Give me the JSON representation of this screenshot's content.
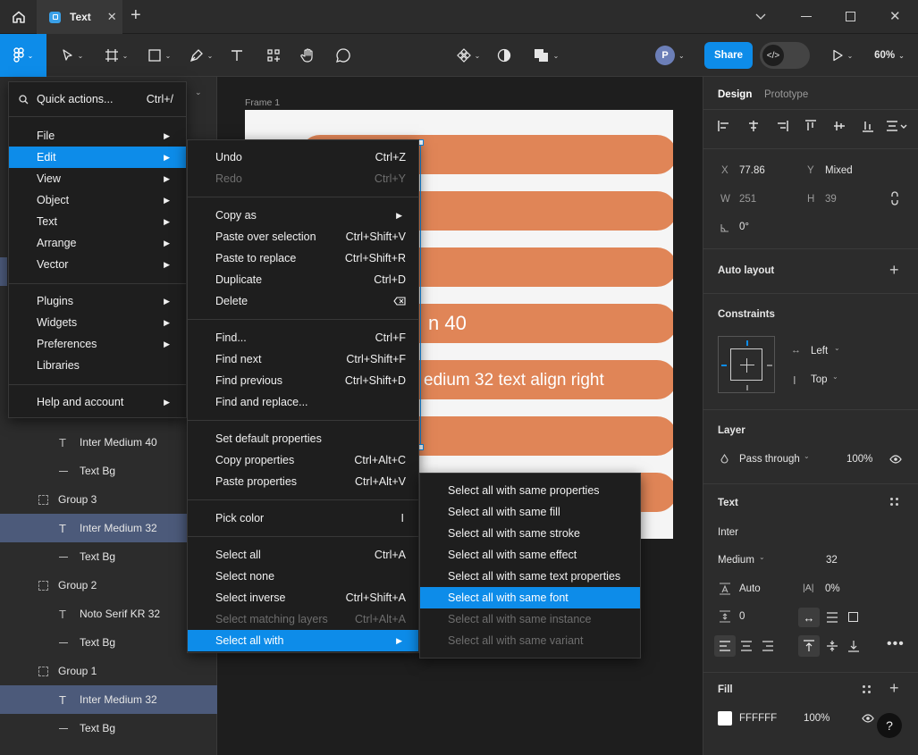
{
  "titlebar": {
    "tab_title": "Text",
    "plus_label": "+"
  },
  "toolbar": {
    "share_label": "Share",
    "avatar_initial": "P",
    "zoom_label": "60%"
  },
  "main_menu": {
    "search_label": "Quick actions...",
    "search_shortcut": "Ctrl+/",
    "items": [
      {
        "label": "File"
      },
      {
        "label": "Edit"
      },
      {
        "label": "View"
      },
      {
        "label": "Object"
      },
      {
        "label": "Text"
      },
      {
        "label": "Arrange"
      },
      {
        "label": "Vector"
      },
      {
        "label": "Plugins"
      },
      {
        "label": "Widgets"
      },
      {
        "label": "Preferences"
      },
      {
        "label": "Libraries"
      },
      {
        "label": "Help and account"
      }
    ]
  },
  "edit_menu": {
    "items": [
      {
        "label": "Undo",
        "shortcut": "Ctrl+Z"
      },
      {
        "label": "Redo",
        "shortcut": "Ctrl+Y"
      },
      {
        "label": "Copy as",
        "shortcut": ""
      },
      {
        "label": "Paste over selection",
        "shortcut": "Ctrl+Shift+V"
      },
      {
        "label": "Paste to replace",
        "shortcut": "Ctrl+Shift+R"
      },
      {
        "label": "Duplicate",
        "shortcut": "Ctrl+D"
      },
      {
        "label": "Delete",
        "shortcut": ""
      },
      {
        "label": "Find...",
        "shortcut": "Ctrl+F"
      },
      {
        "label": "Find next",
        "shortcut": "Ctrl+Shift+F"
      },
      {
        "label": "Find previous",
        "shortcut": "Ctrl+Shift+D"
      },
      {
        "label": "Find and replace...",
        "shortcut": ""
      },
      {
        "label": "Set default properties",
        "shortcut": ""
      },
      {
        "label": "Copy properties",
        "shortcut": "Ctrl+Alt+C"
      },
      {
        "label": "Paste properties",
        "shortcut": "Ctrl+Alt+V"
      },
      {
        "label": "Pick color",
        "shortcut": "I"
      },
      {
        "label": "Select all",
        "shortcut": "Ctrl+A"
      },
      {
        "label": "Select none",
        "shortcut": ""
      },
      {
        "label": "Select inverse",
        "shortcut": "Ctrl+Shift+A"
      },
      {
        "label": "Select matching layers",
        "shortcut": "Ctrl+Alt+A"
      },
      {
        "label": "Select all with",
        "shortcut": ""
      }
    ]
  },
  "select_all_with_menu": {
    "items": [
      {
        "label": "Select all with same properties"
      },
      {
        "label": "Select all with same fill"
      },
      {
        "label": "Select all with same stroke"
      },
      {
        "label": "Select all with same effect"
      },
      {
        "label": "Select all with same text properties"
      },
      {
        "label": "Select all with same font"
      },
      {
        "label": "Select all with same instance"
      },
      {
        "label": "Select all with same variant"
      }
    ]
  },
  "layers": {
    "items": [
      {
        "name": "Inter Medium 40"
      },
      {
        "name": "Text Bg"
      },
      {
        "name": "Group 3"
      },
      {
        "name": "Inter Medium 32"
      },
      {
        "name": "Text Bg"
      },
      {
        "name": "Group 2"
      },
      {
        "name": "Noto Serif KR 32"
      },
      {
        "name": "Text Bg"
      },
      {
        "name": "Group 1"
      },
      {
        "name": "Inter Medium 32"
      },
      {
        "name": "Text Bg"
      }
    ]
  },
  "canvas": {
    "frame_label": "Frame 1",
    "pill_texts": [
      "n 40",
      "edium 32 text align right"
    ]
  },
  "design_panel": {
    "tab_design": "Design",
    "tab_prototype": "Prototype",
    "x_label": "X",
    "x_value": "77.86",
    "y_label": "Y",
    "y_value": "Mixed",
    "w_label": "W",
    "w_value": "251",
    "h_label": "H",
    "h_value": "39",
    "rotation_value": "0°",
    "auto_layout_title": "Auto layout",
    "constraints_title": "Constraints",
    "constraint_h": "Left",
    "constraint_v": "Top",
    "layer_title": "Layer",
    "blend_mode": "Pass through",
    "layer_opacity": "100%",
    "text_title": "Text",
    "font_family": "Inter",
    "font_weight": "Medium",
    "font_size": "32",
    "line_height": "Auto",
    "letter_spacing": "0%",
    "paragraph_spacing": "0",
    "fill_title": "Fill",
    "fill_hex": "FFFFFF",
    "fill_opacity": "100%",
    "help_label": "?"
  },
  "colors": {
    "accent": "#0d8ce9",
    "pill": "#e08557",
    "panel": "#2c2c2c",
    "selection": "#4c5a7a"
  }
}
